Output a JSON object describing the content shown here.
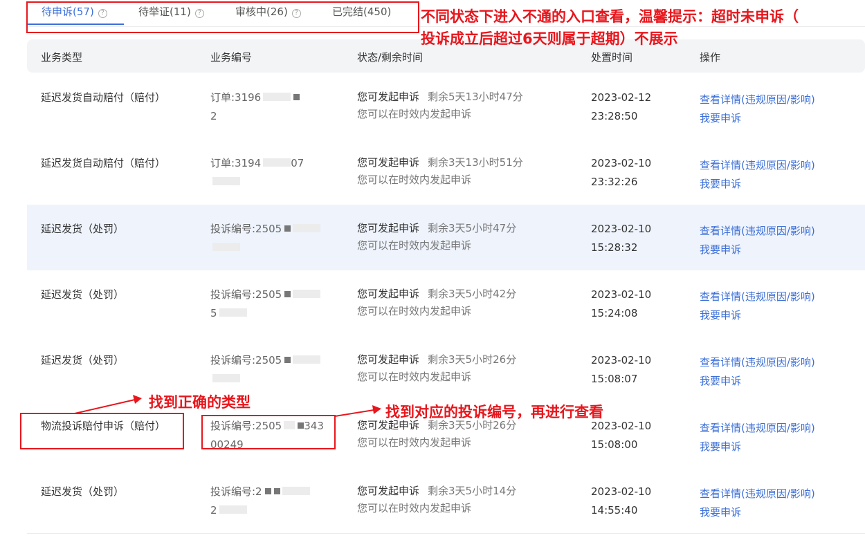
{
  "tabs": [
    {
      "label": "待申诉(57)",
      "help": "?"
    },
    {
      "label": "待举证(11)",
      "help": "?"
    },
    {
      "label": "审核中(26)",
      "help": "?"
    },
    {
      "label": "已完结(450)"
    }
  ],
  "columns": {
    "type": "业务类型",
    "number": "业务编号",
    "status": "状态/剩余时间",
    "time": "处置时间",
    "action": "操作"
  },
  "rows": [
    {
      "type": "延迟发货自动赔付（赔付）",
      "no_line1": "订单:3196",
      "no_line2": "2",
      "status": "您可发起申诉",
      "remain": "剩余5天13小时47分",
      "sub": "您可以在时效内发起申诉",
      "date": "2023-02-12",
      "time": "23:28:50",
      "view": "查看详情(违规原因/影响)",
      "appeal": "我要申诉"
    },
    {
      "type": "延迟发货自动赔付（赔付）",
      "no_line1": "订单:3194",
      "no_line1_tail": "07",
      "no_line2": "",
      "status": "您可发起申诉",
      "remain": "剩余3天13小时51分",
      "sub": "您可以在时效内发起申诉",
      "date": "2023-02-10",
      "time": "23:32:26",
      "view": "查看详情(违规原因/影响)",
      "appeal": "我要申诉"
    },
    {
      "type": "延迟发货（处罚）",
      "no_line1": "投诉编号:2505",
      "no_line2": "",
      "status": "您可发起申诉",
      "remain": "剩余3天5小时47分",
      "sub": "您可以在时效内发起申诉",
      "date": "2023-02-10",
      "time": "15:28:32",
      "view": "查看详情(违规原因/影响)",
      "appeal": "我要申诉"
    },
    {
      "type": "延迟发货（处罚）",
      "no_line1": "投诉编号:2505",
      "no_line2": "5",
      "status": "您可发起申诉",
      "remain": "剩余3天5小时42分",
      "sub": "您可以在时效内发起申诉",
      "date": "2023-02-10",
      "time": "15:24:08",
      "view": "查看详情(违规原因/影响)",
      "appeal": "我要申诉"
    },
    {
      "type": "延迟发货（处罚）",
      "no_line1": "投诉编号:2505",
      "no_line2": "",
      "status": "您可发起申诉",
      "remain": "剩余3天5小时26分",
      "sub": "您可以在时效内发起申诉",
      "date": "2023-02-10",
      "time": "15:08:07",
      "view": "查看详情(违规原因/影响)",
      "appeal": "我要申诉"
    },
    {
      "type": "物流投诉赔付申诉（赔付）",
      "no_line1": "投诉编号:2505",
      "no_line1_tail": "343",
      "no_line2": "00249",
      "status": "您可发起申诉",
      "remain": "剩余3天5小时26分",
      "sub": "您可以在时效内发起申诉",
      "date": "2023-02-10",
      "time": "15:08:00",
      "view": "查看详情(违规原因/影响)",
      "appeal": "我要申诉"
    },
    {
      "type": "延迟发货（处罚）",
      "no_line1": "投诉编号:2",
      "no_line2": "2",
      "status": "您可发起申诉",
      "remain": "剩余3天5小时14分",
      "sub": "您可以在时效内发起申诉",
      "date": "2023-02-10",
      "time": "14:55:40",
      "view": "查看详情(违规原因/影响)",
      "appeal": "我要申诉"
    }
  ],
  "annotations": {
    "top_line1": "不同状态下进入不通的入口查看，温馨提示：超时未申诉（",
    "top_line2": "投诉成立后超过6天则属于超期）不展示",
    "find_type": "找到正确的类型",
    "find_number": "找到对应的投诉编号，再进行查看"
  }
}
